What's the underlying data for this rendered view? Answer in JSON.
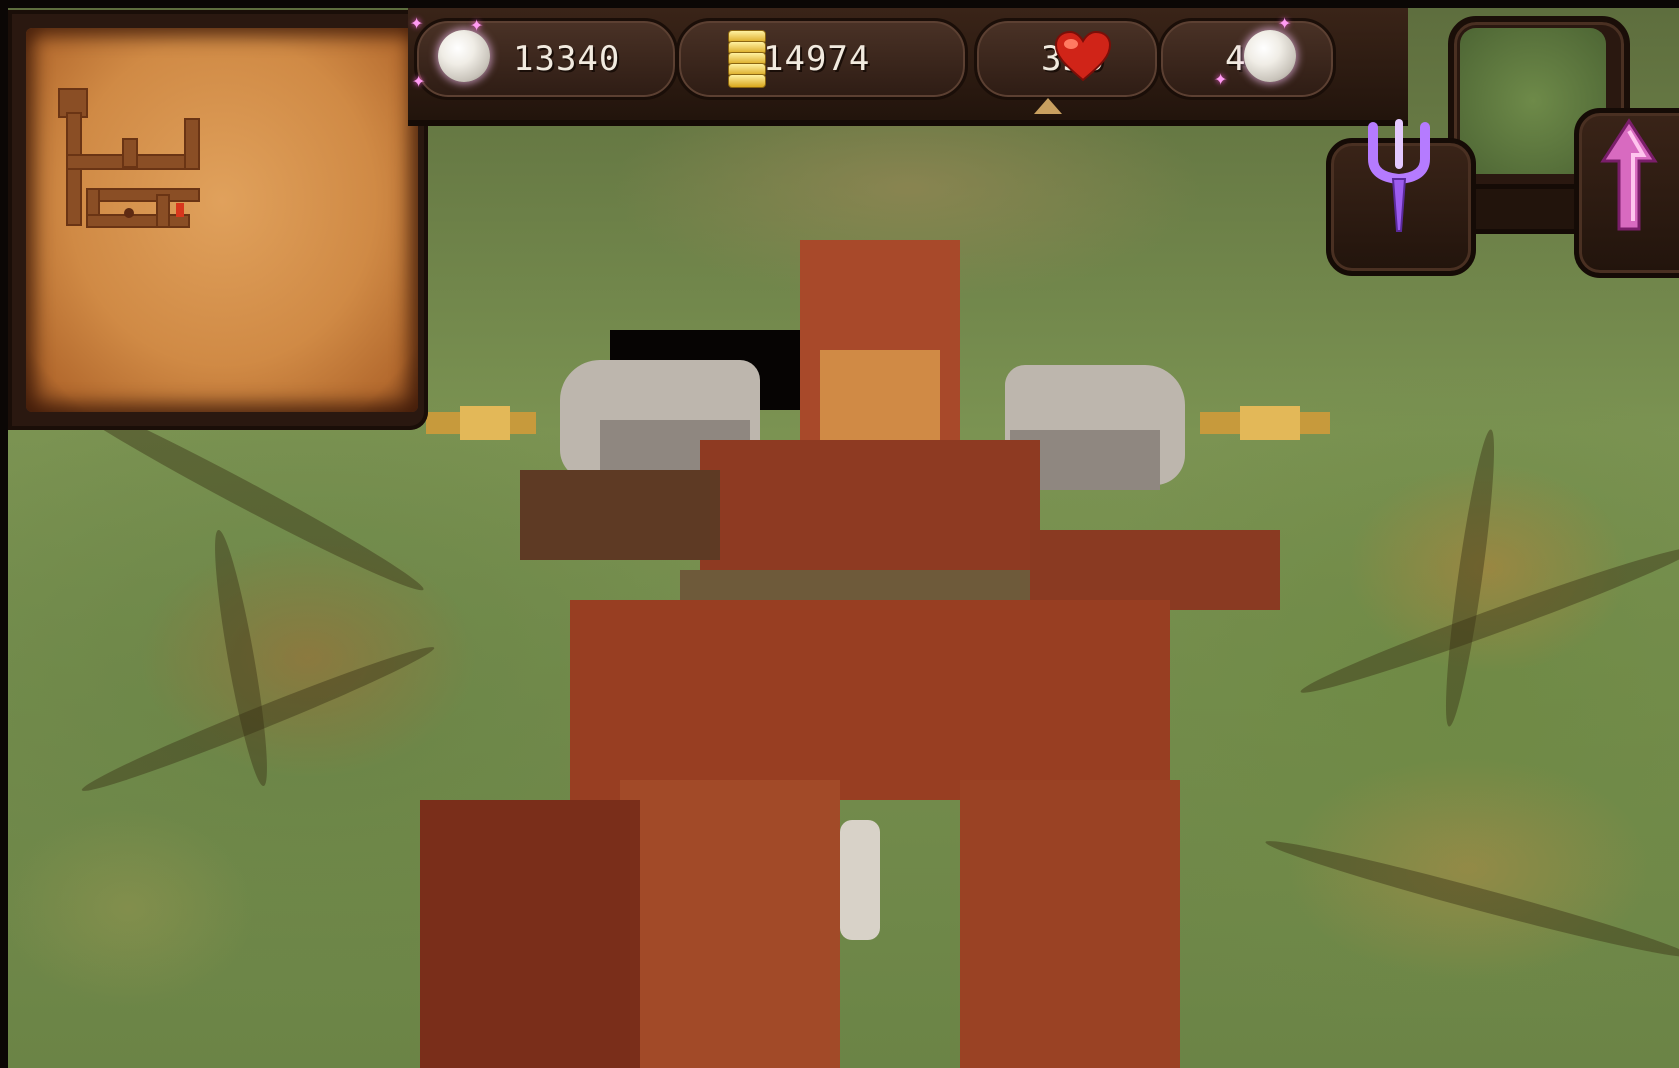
{
  "hud": {
    "orb_counter": "13340",
    "gold_counter": "14974",
    "health_counter": "350",
    "mana_counter": "400"
  },
  "icons": {
    "orb": "white-orb-icon",
    "gold": "gold-coin-stack-icon",
    "health": "red-heart-icon",
    "mana": "white-mana-orb-icon",
    "left_control": "purple-tuning-fork-icon",
    "right_control": "pink-up-arrow-icon"
  },
  "colors": {
    "hud_text": "#f1eadf",
    "hud_frame": "#2e1c14",
    "sparkle": "#ff9bf2",
    "heart": "#d02418",
    "gold": "#e9c040",
    "minimap": "#d08a45",
    "ground": "#7b9352"
  }
}
